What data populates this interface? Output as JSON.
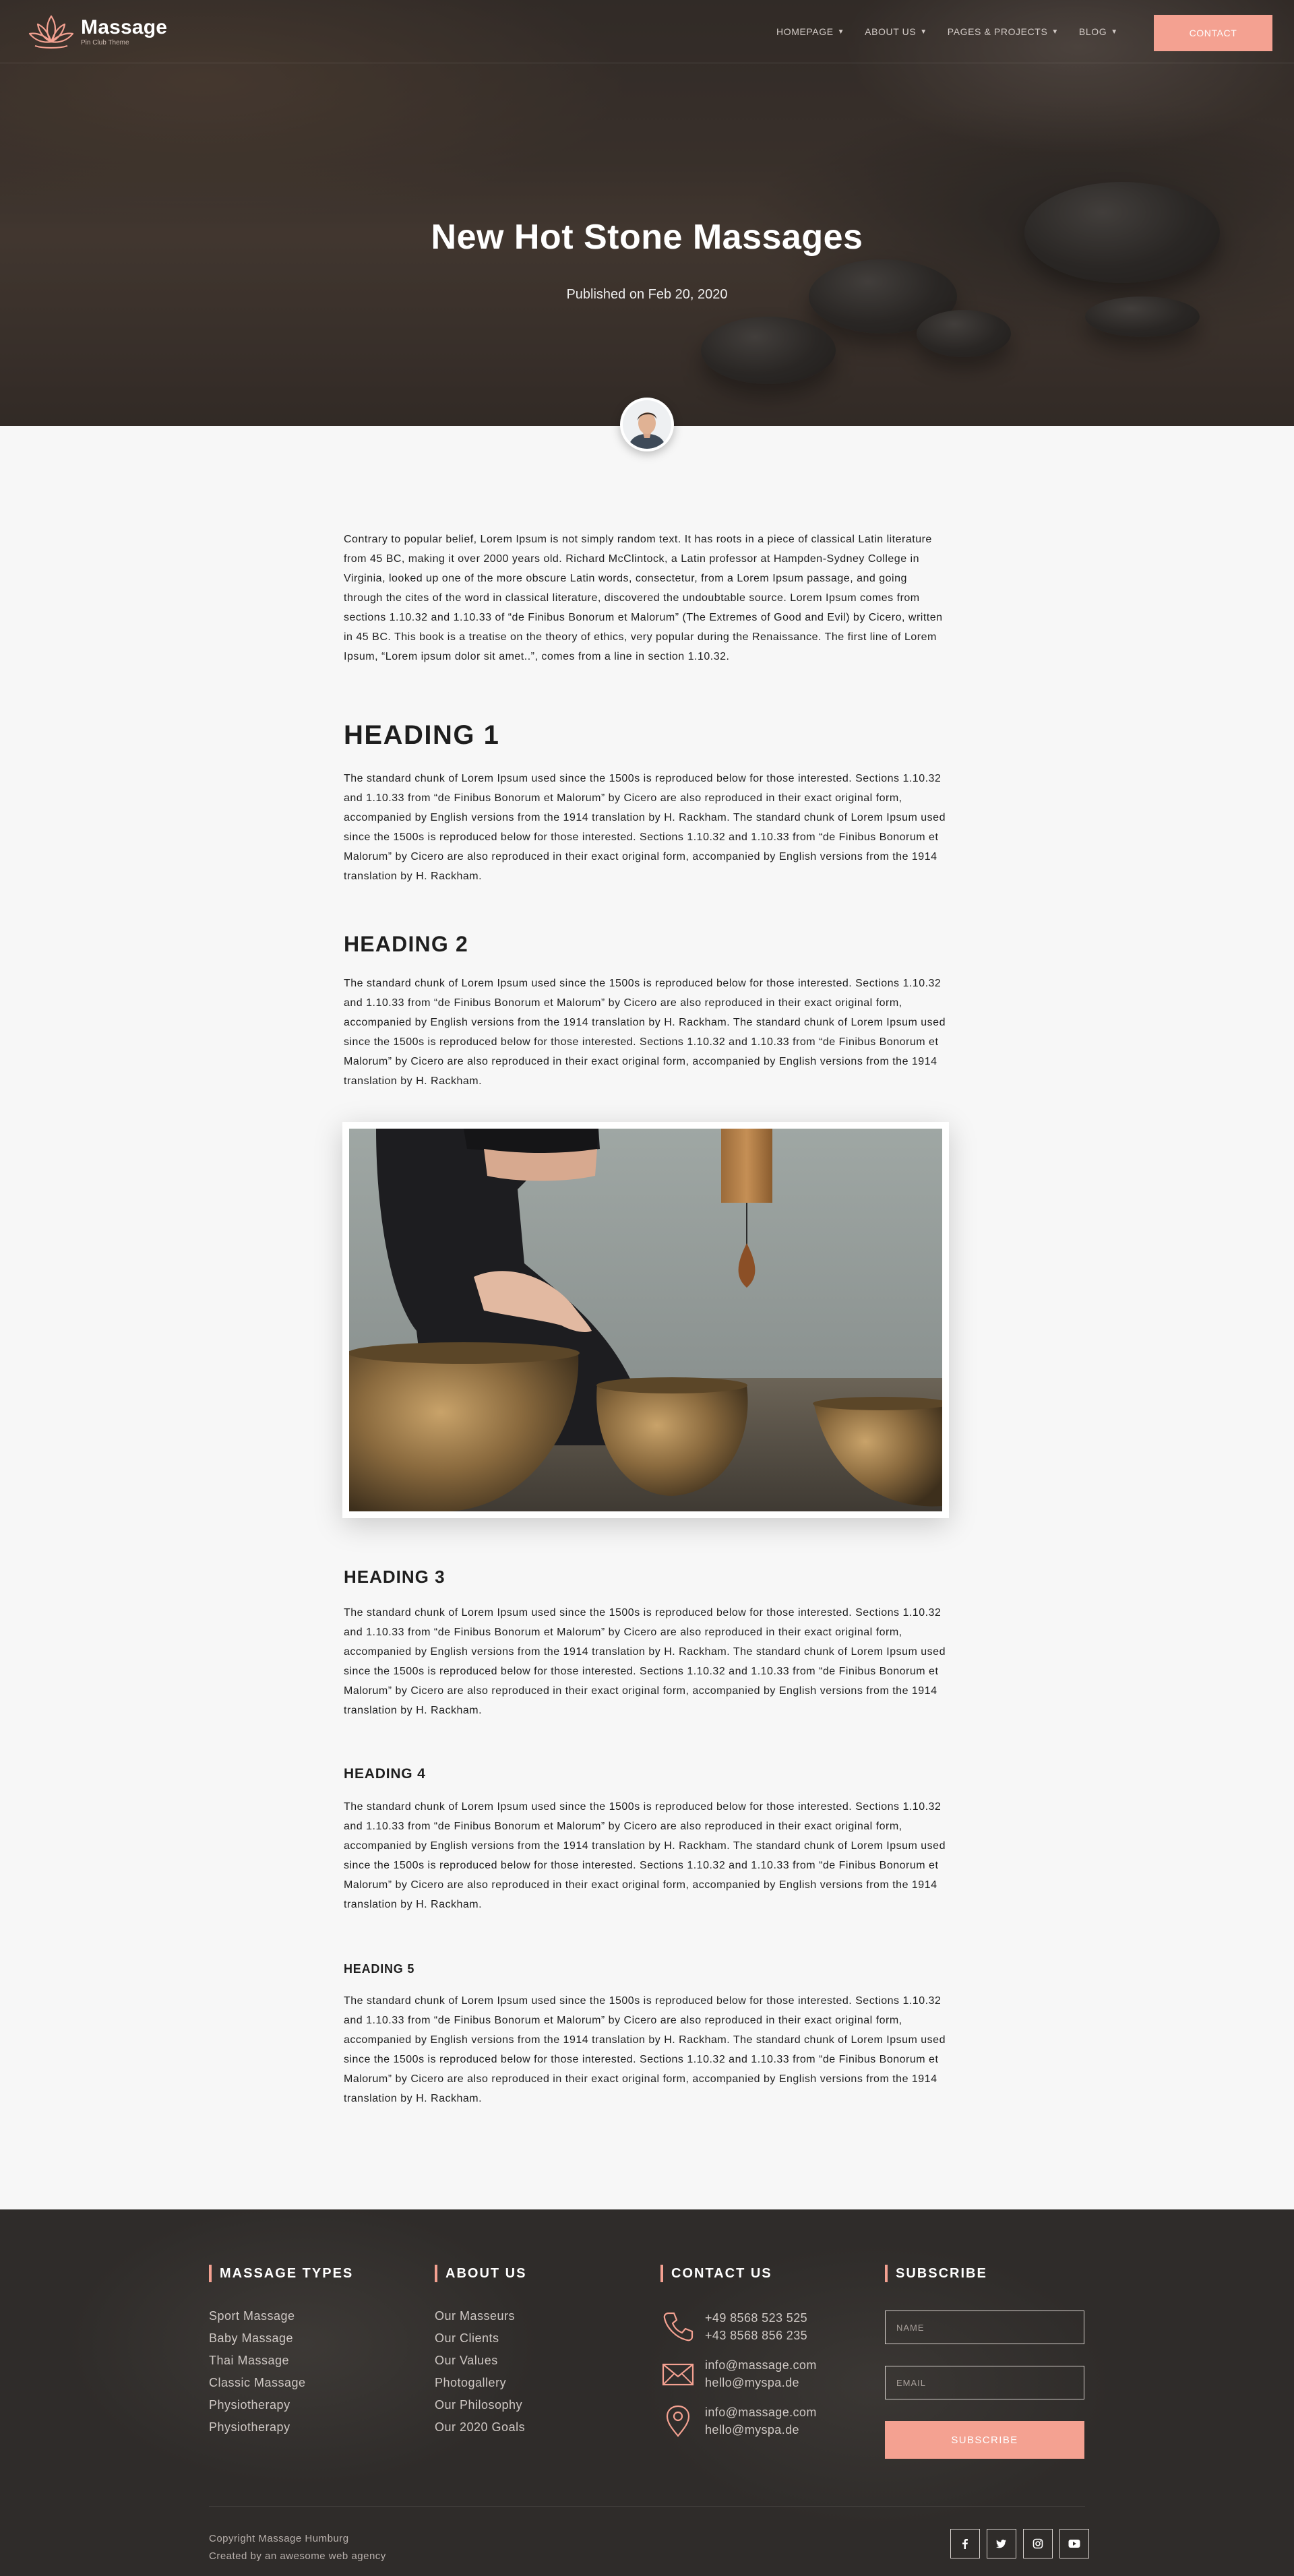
{
  "brand": {
    "name": "Massage",
    "tagline": "Pin Club Theme",
    "accent_color": "#f4a191"
  },
  "nav": {
    "items": [
      {
        "label": "HOMEPAGE",
        "icon": "chevron-down-icon"
      },
      {
        "label": "ABOUT US",
        "icon": "chevron-down-icon"
      },
      {
        "label": "PAGES & PROJECTS",
        "icon": "chevron-down-icon"
      },
      {
        "label": "BLOG",
        "icon": "chevron-down-icon"
      }
    ],
    "contact_label": "CONTACT"
  },
  "hero": {
    "title": "New Hot Stone Massages",
    "published": "Published on Feb 20, 2020"
  },
  "article": {
    "intro": "Contrary to popular belief, Lorem Ipsum is not simply random text. It has roots in a piece of classical Latin literature from 45 BC, making it over 2000 years old. Richard McClintock, a Latin professor at Hampden-Sydney College in Virginia, looked up one of the more obscure Latin words, consectetur, from a Lorem Ipsum passage, and going through the cites of the word in classical literature, discovered the undoubtable source. Lorem Ipsum comes from sections 1.10.32 and 1.10.33 of “de Finibus Bonorum et Malorum” (The Extremes of Good and Evil) by Cicero, written in 45 BC. This book is a treatise on the theory of ethics, very popular during the Renaissance. The first line of Lorem Ipsum, “Lorem ipsum dolor sit amet..”, comes from a line in section 1.10.32.",
    "sections": [
      {
        "heading": "HEADING 1",
        "body": "The standard chunk of Lorem Ipsum used since the 1500s is reproduced below for those interested. Sections 1.10.32 and 1.10.33 from “de Finibus Bonorum et Malorum” by Cicero are also reproduced in their exact original form, accompanied by English versions from the 1914 translation by H. Rackham. The standard chunk of Lorem Ipsum used since the 1500s is reproduced below for those interested. Sections 1.10.32 and 1.10.33 from “de Finibus Bonorum et Malorum” by Cicero are also reproduced in their exact original form, accompanied by English versions from the 1914 translation by H. Rackham."
      },
      {
        "heading": "HEADING 2",
        "body": "The standard chunk of Lorem Ipsum used since the 1500s is reproduced below for those interested. Sections 1.10.32 and 1.10.33 from “de Finibus Bonorum et Malorum” by Cicero are also reproduced in their exact original form, accompanied by English versions from the 1914 translation by H. Rackham. The standard chunk of Lorem Ipsum used since the 1500s is reproduced below for those interested. Sections 1.10.32 and 1.10.33 from “de Finibus Bonorum et Malorum” by Cicero are also reproduced in their exact original form, accompanied by English versions from the 1914 translation by H. Rackham."
      },
      {
        "heading": "HEADING 3",
        "body": "The standard chunk of Lorem Ipsum used since the 1500s is reproduced below for those interested. Sections 1.10.32 and 1.10.33 from “de Finibus Bonorum et Malorum” by Cicero are also reproduced in their exact original form, accompanied by English versions from the 1914 translation by H. Rackham. The standard chunk of Lorem Ipsum used since the 1500s is reproduced below for those interested. Sections 1.10.32 and 1.10.33 from “de Finibus Bonorum et Malorum” by Cicero are also reproduced in their exact original form, accompanied by English versions from the 1914 translation by H. Rackham."
      },
      {
        "heading": "HEADING 4",
        "body": "The standard chunk of Lorem Ipsum used since the 1500s is reproduced below for those interested. Sections 1.10.32 and 1.10.33 from “de Finibus Bonorum et Malorum” by Cicero are also reproduced in their exact original form, accompanied by English versions from the 1914 translation by H. Rackham. The standard chunk of Lorem Ipsum used since the 1500s is reproduced below for those interested. Sections 1.10.32 and 1.10.33 from “de Finibus Bonorum et Malorum” by Cicero are also reproduced in their exact original form, accompanied by English versions from the 1914 translation by H. Rackham."
      },
      {
        "heading": "HEADING 5",
        "body": "The standard chunk of Lorem Ipsum used since the 1500s is reproduced below for those interested. Sections 1.10.32 and 1.10.33 from “de Finibus Bonorum et Malorum” by Cicero are also reproduced in their exact original form, accompanied by English versions from the 1914 translation by H. Rackham. The standard chunk of Lorem Ipsum used since the 1500s is reproduced below for those interested. Sections 1.10.32 and 1.10.33 from “de Finibus Bonorum et Malorum” by Cicero are also reproduced in their exact original form, accompanied by English versions from the 1914 translation by H. Rackham."
      }
    ]
  },
  "footer": {
    "massage_types": {
      "title": "MASSAGE TYPES",
      "items": [
        "Sport Massage",
        "Baby Massage",
        "Thai Massage",
        "Classic Massage",
        "Physiotherapy",
        "Physiotherapy"
      ]
    },
    "about_us": {
      "title": "ABOUT US",
      "items": [
        "Our Masseurs",
        "Our Clients",
        "Our Values",
        "Photogallery",
        "Our Philosophy",
        "Our 2020 Goals"
      ]
    },
    "contact_us": {
      "title": "CONTACT US",
      "rows": [
        {
          "icon": "phone-icon",
          "line1": "+49 8568 523 525",
          "line2": "+43 8568 856 235"
        },
        {
          "icon": "envelope-icon",
          "line1": "info@massage.com",
          "line2": "hello@myspa.de"
        },
        {
          "icon": "map-pin-icon",
          "line1": "info@massage.com",
          "line2": "hello@myspa.de"
        }
      ]
    },
    "subscribe": {
      "title": "SUBSCRIBE",
      "name_placeholder": "NAME",
      "email_placeholder": "EMAIL",
      "button_label": "SUBSCRIBE"
    },
    "copyright": "Copyright Massage Humburg",
    "credit": "Created by an awesome web agency",
    "socials": [
      "facebook-icon",
      "twitter-icon",
      "instagram-icon",
      "youtube-icon"
    ]
  }
}
